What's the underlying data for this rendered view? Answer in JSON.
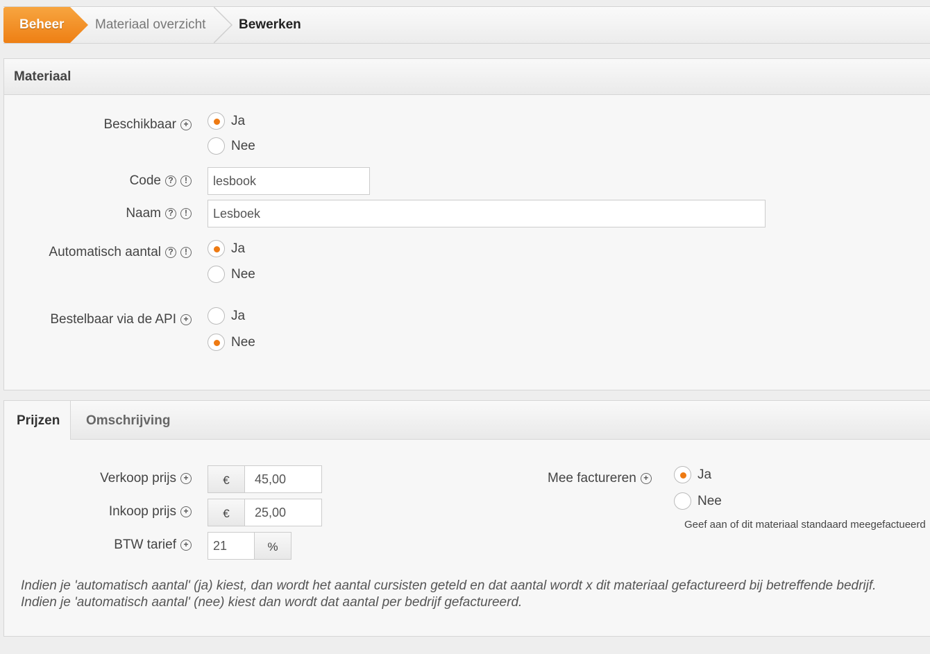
{
  "breadcrumb": {
    "home": "Beheer",
    "middle": "Materiaal overzicht",
    "current": "Bewerken"
  },
  "material_panel": {
    "title": "Materiaal",
    "beschikbaar": {
      "label": "Beschikbaar",
      "yes": "Ja",
      "no": "Nee",
      "selected": "Ja"
    },
    "code": {
      "label": "Code",
      "value": "lesbook"
    },
    "naam": {
      "label": "Naam",
      "value": "Lesboek"
    },
    "automatisch": {
      "label": "Automatisch aantal",
      "yes": "Ja",
      "no": "Nee",
      "selected": "Ja"
    },
    "api": {
      "label": "Bestelbaar via de API",
      "yes": "Ja",
      "no": "Nee",
      "selected": "Nee"
    }
  },
  "tabs": {
    "active": "Prijzen",
    "inactive": "Omschrijving"
  },
  "prices": {
    "verkoop": {
      "label": "Verkoop prijs",
      "currency": "€",
      "value": "45,00"
    },
    "inkoop": {
      "label": "Inkoop prijs",
      "currency": "€",
      "value": "25,00"
    },
    "btw": {
      "label": "BTW tarief",
      "value": "21",
      "unit": "%"
    },
    "mee_factureren": {
      "label": "Mee factureren",
      "yes": "Ja",
      "no": "Nee",
      "selected": "Ja",
      "hint": "Geef aan of dit materiaal standaard meegefactueerd"
    },
    "note_line1": "Indien je 'automatisch aantal' (ja) kiest, dan wordt het aantal cursisten geteld en dat aantal wordt x dit materiaal gefactureerd bij betreffende bedrijf.",
    "note_line2": "Indien je 'automatisch aantal' (nee) kiest dan wordt dat aantal per bedrijf gefactureerd."
  },
  "colors": {
    "accent": "#ee7f14",
    "radio_dot": "#ee7a12"
  },
  "icons": {
    "plus": "plus-circle-icon",
    "help": "help-circle-icon",
    "info": "info-circle-icon"
  }
}
